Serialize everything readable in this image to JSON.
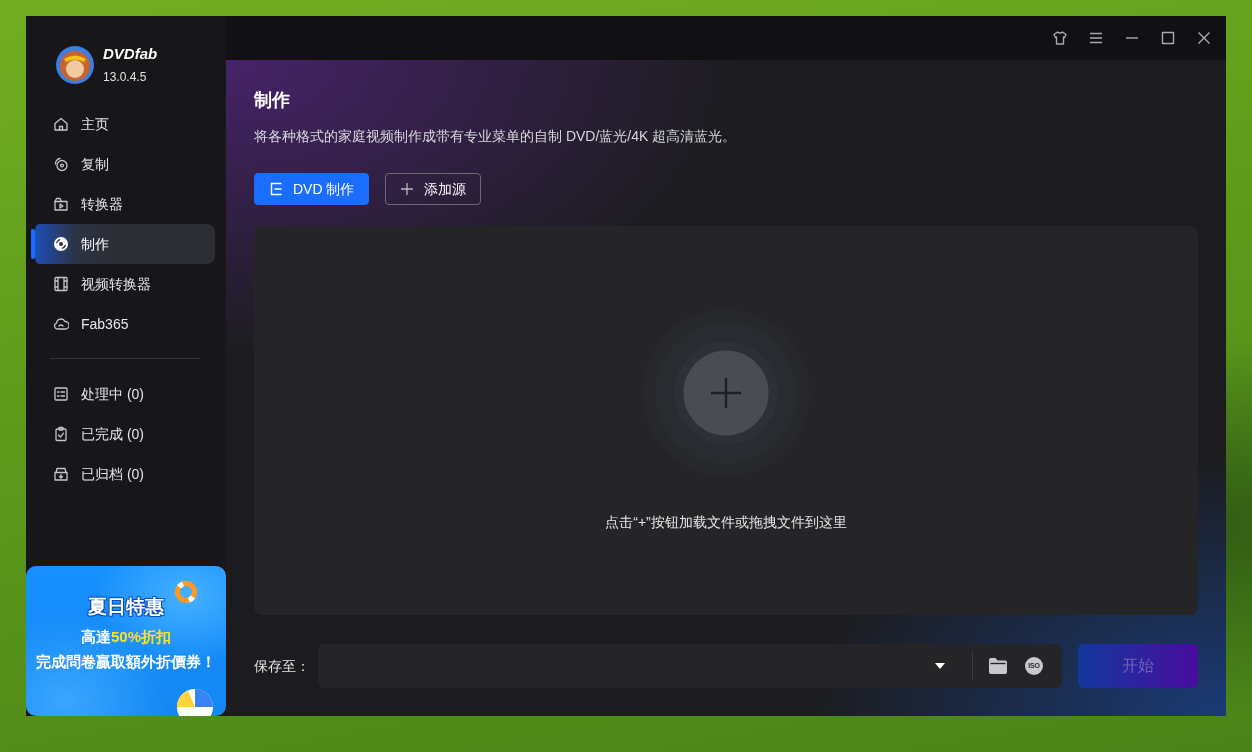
{
  "app": {
    "name": "DVDfab",
    "version": "13.0.4.5"
  },
  "sidebar": {
    "items": [
      {
        "label": "主页",
        "selected": false
      },
      {
        "label": "复制",
        "selected": false
      },
      {
        "label": "转换器",
        "selected": false
      },
      {
        "label": "制作",
        "selected": true
      },
      {
        "label": "视频转换器",
        "selected": false
      },
      {
        "label": "Fab365",
        "selected": false
      }
    ],
    "queue_items": [
      {
        "label": "处理中 (0)",
        "selected": false
      },
      {
        "label": "已完成 (0)",
        "selected": false
      },
      {
        "label": "已归档 (0)",
        "selected": false
      }
    ]
  },
  "promo": {
    "title": "夏日特惠",
    "offer_prefix": "高達",
    "offer_highlight": "50%折扣",
    "note": "完成問卷贏取額外折價券！"
  },
  "page": {
    "title": "制作",
    "description": "将各种格式的家庭视频制作成带有专业菜单的自制 DVD/蓝光/4K 超高清蓝光。"
  },
  "toolbar": {
    "buttons": [
      {
        "label": "DVD 制作",
        "kind": "primary"
      },
      {
        "label": "添加源",
        "kind": "outline"
      }
    ]
  },
  "drop_zone": {
    "hint": "点击“+”按钮加载文件或拖拽文件到这里"
  },
  "output": {
    "label": "保存至：",
    "iso_badge": "ISO"
  },
  "start_button": {
    "label": "开始",
    "disabled": true
  }
}
